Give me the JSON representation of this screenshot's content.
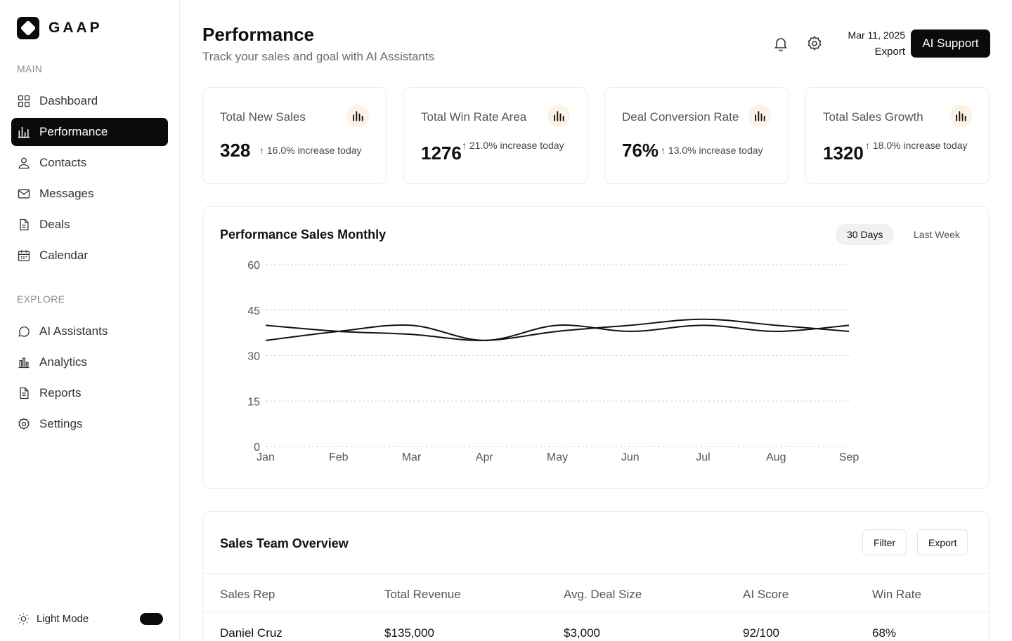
{
  "app": {
    "logo_text": "GAAP"
  },
  "sidebar": {
    "main_label": "MAIN",
    "main_items": [
      {
        "label": "Dashboard",
        "icon": "grid-icon"
      },
      {
        "label": "Performance",
        "icon": "bar-chart-icon",
        "active": true
      },
      {
        "label": "Contacts",
        "icon": "user-icon"
      },
      {
        "label": "Messages",
        "icon": "mail-icon"
      },
      {
        "label": "Deals",
        "icon": "document-icon"
      },
      {
        "label": "Calendar",
        "icon": "calendar-icon"
      }
    ],
    "explore_label": "EXPLORE",
    "explore_items": [
      {
        "label": "AI Assistants",
        "icon": "chat-bubble-icon"
      },
      {
        "label": "Analytics",
        "icon": "analytics-icon"
      },
      {
        "label": "Reports",
        "icon": "report-icon"
      },
      {
        "label": "Settings",
        "icon": "gear-icon"
      }
    ],
    "theme_label": "Light Mode"
  },
  "header": {
    "title": "Performance",
    "subtitle": "Track your sales and goal with AI Assistants",
    "date": "Mar 11, 2025",
    "export_label": "Export",
    "ai_button": "AI Support"
  },
  "stats": [
    {
      "title": "Total New Sales",
      "value": "328",
      "delta": "16.0% increase today"
    },
    {
      "title": "Total Win Rate Area",
      "value": "1276",
      "delta": "21.0% increase today"
    },
    {
      "title": "Deal Conversion Rate",
      "value": "76%",
      "delta": "13.0% increase today"
    },
    {
      "title": "Total Sales Growth",
      "value": "1320",
      "delta": "18.0% increase today"
    }
  ],
  "chart_panel": {
    "title": "Performance Sales Monthly",
    "range_options": [
      "30 Days",
      "Last Week"
    ],
    "selected_range": "30 Days"
  },
  "chart_data": {
    "type": "line",
    "categories": [
      "Jan",
      "Feb",
      "Mar",
      "Apr",
      "May",
      "Jun",
      "Jul",
      "Aug",
      "Sep"
    ],
    "series": [
      {
        "values": [
          40,
          38,
          37,
          35,
          38,
          40,
          42,
          40,
          38
        ]
      },
      {
        "values": [
          35,
          38,
          40,
          35,
          40,
          38,
          40,
          38,
          40
        ]
      }
    ],
    "ylim": [
      0,
      60
    ],
    "yticks": [
      0,
      15,
      30,
      45,
      60
    ],
    "grid": true,
    "line_color": "#111111",
    "grid_color": "#d9d9d9"
  },
  "table": {
    "title": "Sales Team Overview",
    "filter_label": "Filter",
    "export_label": "Export",
    "columns": [
      "Sales Rep",
      "Total Revenue",
      "Avg. Deal Size",
      "AI Score",
      "Win Rate"
    ],
    "rows": [
      [
        "Daniel Cruz",
        "$135,000",
        "$3,000",
        "92/100",
        "68%"
      ]
    ]
  },
  "colors": {
    "accent": "#0b0b0b",
    "icon_bg": "#fdf2e6"
  }
}
